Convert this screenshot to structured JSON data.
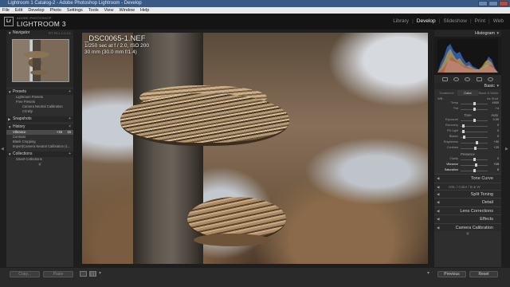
{
  "window": {
    "title": "Lightroom 1 Catalog-2 - Adobe Photoshop Lightroom - Develop"
  },
  "menu": [
    "File",
    "Edit",
    "Develop",
    "Photo",
    "Settings",
    "Tools",
    "View",
    "Window",
    "Help"
  ],
  "identity": {
    "badge": "Lr",
    "brand_small": "ADOBE PHOTOSHOP",
    "brand_big": "LIGHTROOM 3",
    "modules": [
      "Library",
      "Develop",
      "Slideshow",
      "Print",
      "Web"
    ],
    "active_module": "Develop"
  },
  "left": {
    "navigator": {
      "title": "Navigator",
      "zoom_options": "FIT   FILL   1:1   3:1"
    },
    "presets": {
      "title": "Presets",
      "items": [
        "Lightroom Presets",
        "Free Presets",
        "Camera Neutral Calibration",
        "Crinkly"
      ]
    },
    "snapshots": {
      "title": "Snapshots"
    },
    "history": {
      "title": "History",
      "items": [
        {
          "label": "Vibrance",
          "value": "+15",
          "value2": "15",
          "selected": true
        },
        {
          "label": "Contrast",
          "value": "",
          "value2": "",
          "selected": false
        },
        {
          "label": "Blank Cropping",
          "value": "",
          "value2": "",
          "selected": false
        },
        {
          "label": "Import(Camera Neutral Calibration (1...",
          "value": "",
          "value2": "",
          "selected": false
        }
      ]
    },
    "collections": {
      "title": "Collections",
      "items": [
        "Smart Collections"
      ]
    },
    "copy_label": "Copy...",
    "paste_label": "Paste"
  },
  "photo": {
    "filename": "_DSC0065-1.NEF",
    "exposure": "1/250 sec at f / 2.0, ISO 200",
    "focal": "30 mm (30.0 mm f/1.4)"
  },
  "right": {
    "histogram": {
      "title": "Histogram"
    },
    "basic": {
      "title": "Basic",
      "treatment_label": "Treatment :",
      "treatment_tabs": [
        "Color",
        "Black & White"
      ],
      "wb_label": "WB :",
      "wb_value": "As Shot",
      "temp_tint": [
        {
          "label": "Temp",
          "value": "4900",
          "pos": 0.52
        },
        {
          "label": "Tint",
          "value": "+4",
          "pos": 0.5
        }
      ],
      "tone_label": "Tone",
      "tone_auto": "Auto",
      "tone_sliders": [
        {
          "label": "Exposure",
          "value": "0.00",
          "pos": 0.5
        },
        {
          "label": "Recovery",
          "value": "0",
          "pos": 0.05
        },
        {
          "label": "Fill Light",
          "value": "0",
          "pos": 0.05
        },
        {
          "label": "Blacks",
          "value": "5",
          "pos": 0.1
        },
        {
          "label": "Brightness",
          "value": "+50",
          "pos": 0.62
        },
        {
          "label": "Contrast",
          "value": "+25",
          "pos": 0.56
        }
      ],
      "presence_label": "Presence",
      "presence_sliders": [
        {
          "label": "Clarity",
          "value": "0",
          "pos": 0.5,
          "hl": false
        },
        {
          "label": "Vibrance",
          "value": "+15",
          "pos": 0.58,
          "hl": true
        },
        {
          "label": "Saturation",
          "value": "0",
          "pos": 0.5,
          "hl": true
        }
      ]
    },
    "tone_curve": "Tone Curve",
    "hsl": {
      "labels": "HSL  /  Color  /  B & W"
    },
    "split_toning": "Split Toning",
    "detail": "Detail",
    "lens_corrections": "Lens Corrections",
    "effects": "Effects",
    "camera_calibration": "Camera Calibration",
    "previous_label": "Previous",
    "reset_label": "Reset"
  },
  "colors": {
    "titlebar": "#3a5a86",
    "panel": "#2e2e2e",
    "background": "#1e1e1e"
  }
}
